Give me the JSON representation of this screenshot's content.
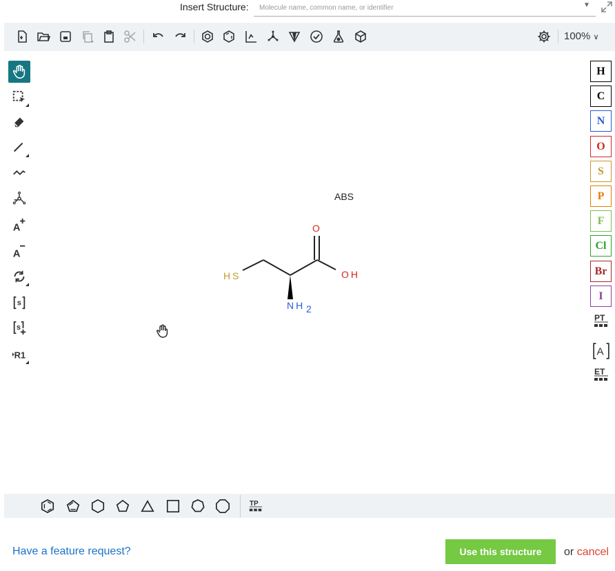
{
  "insert": {
    "label": "Insert Structure:",
    "placeholder": "Molecule name, common name, or identifier"
  },
  "toolbar": {
    "zoom": "100%",
    "icons": [
      "new-document-icon",
      "open-folder-icon",
      "save-icon",
      "copy-icon",
      "paste-icon",
      "cut-icon",
      "undo-icon",
      "redo-icon",
      "aromatize-icon",
      "dearomatize-icon",
      "layout-icon",
      "clean-icon",
      "stereo-icon",
      "check-icon",
      "analyze-icon",
      "3d-view-icon",
      "settings-icon"
    ]
  },
  "left_tools": [
    {
      "name": "hand-tool",
      "active": true
    },
    {
      "name": "select-tool"
    },
    {
      "name": "eraser-tool"
    },
    {
      "name": "bond-tool"
    },
    {
      "name": "chain-tool"
    },
    {
      "name": "template-tool"
    },
    {
      "name": "charge-plus-tool",
      "label": "A+"
    },
    {
      "name": "charge-minus-tool",
      "label": "A−"
    },
    {
      "name": "rotate-tool"
    },
    {
      "name": "sgroup-tool",
      "label": "[s]"
    },
    {
      "name": "sgroup-plus-tool",
      "label": "[s]+"
    },
    {
      "name": "rgroup-tool",
      "label": "R1"
    }
  ],
  "atoms": [
    {
      "symbol": "H",
      "color": "#000000"
    },
    {
      "symbol": "C",
      "color": "#000000"
    },
    {
      "symbol": "N",
      "color": "#2a5bd7"
    },
    {
      "symbol": "O",
      "color": "#d8261c"
    },
    {
      "symbol": "S",
      "color": "#c7972a"
    },
    {
      "symbol": "P",
      "color": "#e87c00"
    },
    {
      "symbol": "F",
      "color": "#7bbe4c"
    },
    {
      "symbol": "Cl",
      "color": "#2aa52a"
    },
    {
      "symbol": "Br",
      "color": "#a52a2a"
    },
    {
      "symbol": "I",
      "color": "#8c3c9c"
    }
  ],
  "right_extra": {
    "pt": "PT",
    "any_atom": "A",
    "et": "ET"
  },
  "molecule": {
    "abs_label": "ABS",
    "sh_label": "HS",
    "o_label": "O",
    "oh_label": "OH",
    "nh2_label": "NH",
    "nh2_sub": "2"
  },
  "bottom_templates": [
    "benzene-template",
    "cyclopentadiene-template",
    "cyclohexane-template",
    "cyclopentane-template",
    "cyclopropane-template",
    "cyclobutane-template",
    "cycloheptane-template",
    "cyclooctane-template"
  ],
  "bottom_tp": "TP",
  "footer": {
    "feature_link": "Have a feature request?",
    "use_button": "Use this structure",
    "or": "or",
    "cancel": "cancel"
  },
  "colors": {
    "accent": "#167782",
    "use_button": "#75c943",
    "link": "#1a73c7",
    "cancel": "#d9432e",
    "toolbar_bg": "#eff2f5"
  }
}
